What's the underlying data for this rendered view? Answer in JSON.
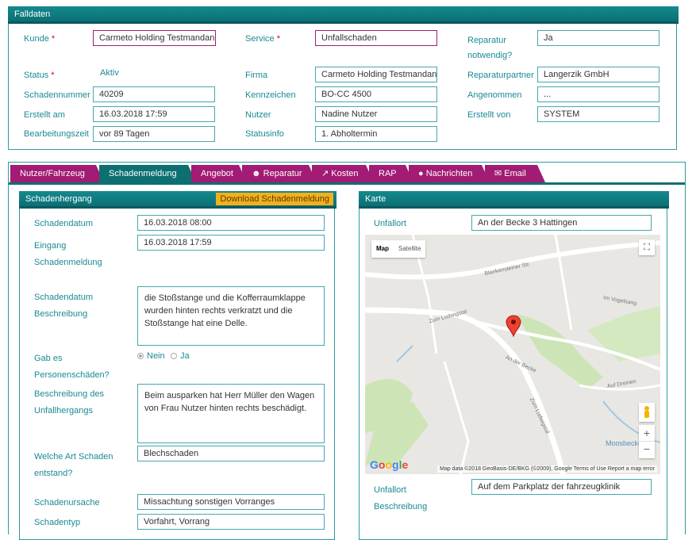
{
  "falldaten": {
    "title": "Falldaten",
    "kunde_label": "Kunde",
    "kunde_value": "Carmeto Holding Testmandan",
    "service_label": "Service",
    "service_value": "Unfallschaden",
    "reparatur_label": "Reparatur notwendig?",
    "reparatur_value": "Ja",
    "status_label": "Status",
    "status_value": "Aktiv",
    "firma_label": "Firma",
    "firma_value": "Carmeto Holding Testmandan",
    "partner_label": "Reparaturpartner",
    "partner_value": "Langerzik GmbH",
    "schadennummer_label": "Schadennummer",
    "schadennummer_value": "40209",
    "kennzeichen_label": "Kennzeichen",
    "kennzeichen_value": "BO-CC 4500",
    "angenommen_label": "Angenommen",
    "angenommen_value": "...",
    "erstellt_label": "Erstellt am",
    "erstellt_value": "16.03.2018 17:59",
    "nutzer_label": "Nutzer",
    "nutzer_value": "Nadine Nutzer",
    "erstellt_von_label": "Erstellt von",
    "erstellt_von_value": "SYSTEM",
    "bearbeitung_label": "Bearbeitungszeit",
    "bearbeitung_value": "vor 89 Tagen",
    "statusinfo_label": "Statusinfo",
    "statusinfo_value": "1. Abholtermin"
  },
  "tabs": [
    {
      "label": "Nutzer/Fahrzeug"
    },
    {
      "label": "Schadenmeldung"
    },
    {
      "label": "Angebot"
    },
    {
      "label": "Reparatur"
    },
    {
      "label": "Kosten"
    },
    {
      "label": "RAP"
    },
    {
      "label": "Nachrichten"
    },
    {
      "label": "Email"
    }
  ],
  "schadenhergang": {
    "title": "Schadenhergang",
    "download_label": "Download Schadenmeldung",
    "schadendatum_label": "Schadendatum",
    "schadendatum_value": "16.03.2018 08:00",
    "eingang_label": "Eingang Schadenmeldung",
    "eingang_value": "16.03.2018 17:59",
    "beschreibung_label": "Schadendatum Beschreibung",
    "beschreibung_value": "die Stoßstange und die Kofferraumklappe wurden hinten rechts verkratzt und die Stoßstange hat eine Delle.",
    "personen_label": "Gab es Personenschäden?",
    "radio_nein": "Nein",
    "radio_ja": "Ja",
    "unfallhergang_label": "Beschreibung des Unfallhergangs",
    "unfallhergang_value": "Beim ausparken hat Herr Müller den Wagen von Frau Nutzer hinten rechts beschädigt.",
    "art_label": "Welche Art Schaden entstand?",
    "art_value": "Blechschaden",
    "ursache_label": "Schadenursache",
    "ursache_value": "Missachtung sonstigen Vorranges",
    "typ_label": "Schadentyp",
    "typ_value": "Vorfahrt, Vorrang"
  },
  "karte": {
    "title": "Karte",
    "unfallort_label": "Unfallort",
    "unfallort_value": "An der Becke 3 Hattingen",
    "beschreibung_label": "Unfallort Beschreibung",
    "beschreibung_value": "Auf dem Parkplatz der fahrzeugklinik",
    "map_button": "Map",
    "satellite_button": "Satellite",
    "attribution": "Map data ©2018 GeoBasis-DE/BKG (©2009), Google   Terms of Use   Report a map error",
    "street_labels": [
      "Blankensteiner Str.",
      "Zum Ludwigstal",
      "Zum Ludwigstal",
      "An der Becke",
      "Im Vogelsang",
      "Auf Dreinen",
      "Moosbecke"
    ]
  }
}
